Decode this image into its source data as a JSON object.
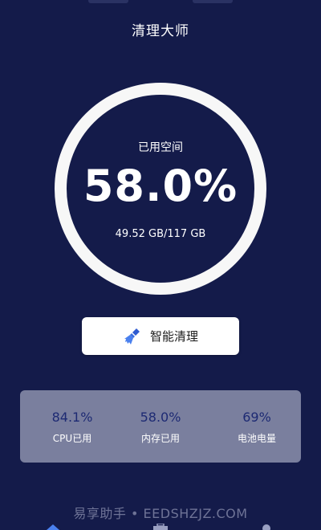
{
  "header": {
    "title": "清理大师"
  },
  "storage": {
    "label": "已用空间",
    "percent": "58.0%",
    "size": "49.52 GB/117 GB",
    "used_fraction": 0.58
  },
  "clean_button": {
    "label": "智能清理",
    "icon": "broom-icon"
  },
  "stats": [
    {
      "value": "84.1%",
      "caption": "CPU已用"
    },
    {
      "value": "58.0%",
      "caption": "内存已用"
    },
    {
      "value": "69%",
      "caption": "电池电量"
    }
  ],
  "watermark": "易享助手 • EEDSHZJZ.COM",
  "nav": {
    "icons": [
      "home-icon",
      "toolbox-icon",
      "profile-icon"
    ]
  },
  "colors": {
    "background": "#141b4a",
    "ring": "#f7f7f7",
    "panel": "#7a7f9e",
    "stat_value": "#1d2a73",
    "broom": "#3b6fe0"
  }
}
